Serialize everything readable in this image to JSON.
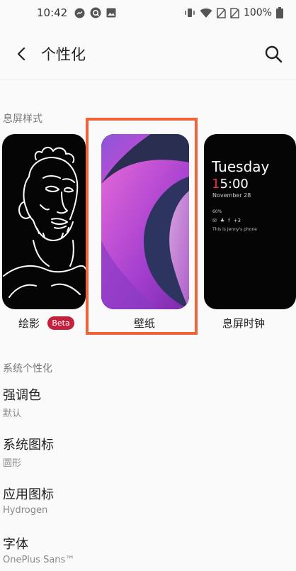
{
  "status_bar": {
    "time": "10:42",
    "battery_percent": "100%",
    "icons": [
      "messenger-icon",
      "q-app-icon",
      "image-icon",
      "vibrate-icon",
      "wifi-icon",
      "no-sim-icon",
      "no-sim-icon",
      "battery-icon"
    ]
  },
  "header": {
    "title": "个性化",
    "back_icon": "chevron-left-icon",
    "search_icon": "search-icon"
  },
  "lock_screen_section": {
    "header": "息屏样式",
    "cards": [
      {
        "label": "绘影",
        "badge": "Beta"
      },
      {
        "label": "壁纸"
      },
      {
        "label": "息屏时钟"
      }
    ],
    "clock_preview": {
      "day": "Tuesday",
      "time_first_digit": "1",
      "time_rest": "5:00",
      "date": "November 28",
      "battery": "60%",
      "notifications": [
        "✉",
        "♣",
        "f",
        "+3"
      ],
      "owner": "This is Jenny's phone"
    },
    "highlight_color": "#f0643a"
  },
  "system_section": {
    "header": "系统个性化",
    "items": [
      {
        "title": "强调色",
        "value": "默认"
      },
      {
        "title": "系统图标",
        "value": "圆形"
      },
      {
        "title": "应用图标",
        "value": "Hydrogen"
      },
      {
        "title": "字体",
        "value": "OnePlus Sans™"
      }
    ]
  },
  "colors": {
    "background": "#fafafa",
    "beta_badge": "#c3203e",
    "clock_accent": "#e5304a"
  }
}
